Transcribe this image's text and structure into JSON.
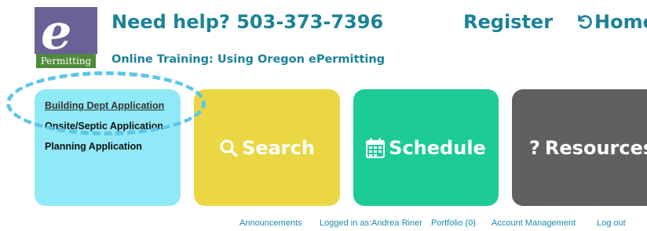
{
  "logo": {
    "label": "Permitting",
    "glyph": "e"
  },
  "header": {
    "help_text": "Need help? 503-373-7396",
    "subtitle": "Online Training: Using Oregon ePermitting",
    "register_label": "Register",
    "home_label": "Home"
  },
  "tiles": {
    "applications": [
      {
        "label": "Building Dept Application"
      },
      {
        "label": "Onsite/Septic Application"
      },
      {
        "label": "Planning Application"
      }
    ],
    "search_label": "Search",
    "schedule_label": "Schedule",
    "resources_label": "Resources"
  },
  "footer": {
    "announcements": "Announcements",
    "logged_in": "Logged in as:Andrea Riner",
    "portfolio": "Portfolio (0)",
    "account": "Account Management",
    "logout": "Log out"
  },
  "colors": {
    "accent": "#1a8299",
    "applications_tile": "#90e9f6",
    "search_tile": "#ead743",
    "schedule_tile": "#1ccb95",
    "resources_tile": "#606060",
    "highlight": "#5dc6ea",
    "logo_purple": "#6a6296",
    "logo_green": "#4f8a3b"
  }
}
